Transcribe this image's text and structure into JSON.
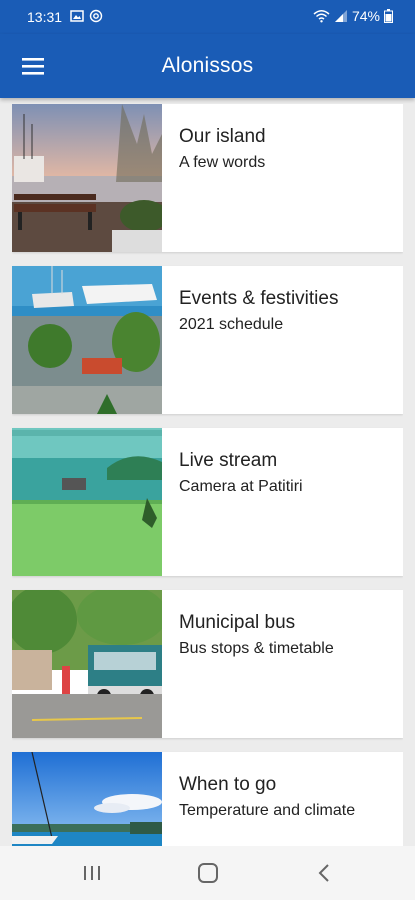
{
  "status_bar": {
    "time": "13:31",
    "battery": "74%",
    "icons": [
      "image-icon",
      "at-sign-icon",
      "wifi-icon",
      "signal-icon",
      "battery-icon"
    ]
  },
  "app_bar": {
    "title": "Alonissos",
    "menu_icon": "hamburger-menu-icon",
    "background": "#1a5cb6"
  },
  "cards": [
    {
      "title": "Our island",
      "subtitle": "A few words",
      "image": "seaside-harbor-bench-photo"
    },
    {
      "title": "Events & festivities",
      "subtitle": "2021 schedule",
      "image": "harbor-festival-boats-photo"
    },
    {
      "title": "Live stream",
      "subtitle": "Camera at Patitiri",
      "image": "harbor-webcam-photo"
    },
    {
      "title": "Municipal bus",
      "subtitle": "Bus stops & timetable",
      "image": "bus-stop-photo"
    },
    {
      "title": "When to go",
      "subtitle": "Temperature and climate",
      "image": "sailboat-sea-photo"
    }
  ],
  "nav_bar": {
    "buttons": [
      "recent-apps-icon",
      "home-icon",
      "back-icon"
    ]
  }
}
